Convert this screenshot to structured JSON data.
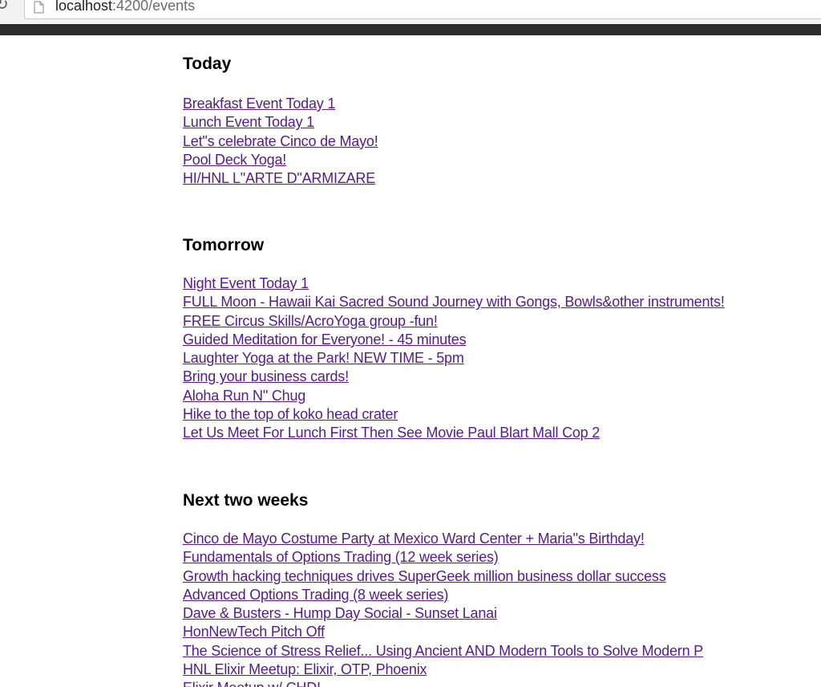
{
  "browser": {
    "url_host": "localhost",
    "url_path": ":4200/events"
  },
  "sections": [
    {
      "title": "Today",
      "events": [
        "Breakfast Event Today 1",
        "Lunch Event Today 1",
        "Let\"s celebrate Cinco de Mayo!",
        "Pool Deck Yoga!",
        "HI/HNL L\"ARTE D\"ARMIZARE"
      ]
    },
    {
      "title": "Tomorrow",
      "events": [
        "Night Event Today 1",
        "FULL Moon - Hawaii Kai Sacred Sound Journey with Gongs, Bowls&other instruments!",
        "FREE Circus Skills/AcroYoga group -fun!",
        "Guided Meditation for Everyone! - 45 minutes",
        "Laughter Yoga at the Park! NEW TIME - 5pm",
        "Bring your business cards!",
        "Aloha Run N\" Chug",
        "Hike to the top of koko head crater",
        "Let Us Meet For Lunch First Then See Movie Paul Blart Mall Cop 2"
      ]
    },
    {
      "title": "Next two weeks",
      "events": [
        "Cinco de Mayo Costume Party at Mexico Ward Center + Maria\"s Birthday!",
        "Fundamentals of Options Trading (12 week series)",
        "Growth hacking techniques drives SuperGeek million business dollar success",
        "Advanced Options Trading (8 week series)",
        "Dave & Busters - Hump Day Social - Sunset Lanai",
        "HonNewTech Pitch Off",
        "The Science of Stress Relief... Using Ancient AND Modern Tools to Solve Modern P",
        "HNL Elixir Meetup: Elixir, OTP, Phoenix",
        "Elixir Meetup w/ CHDI"
      ]
    }
  ]
}
